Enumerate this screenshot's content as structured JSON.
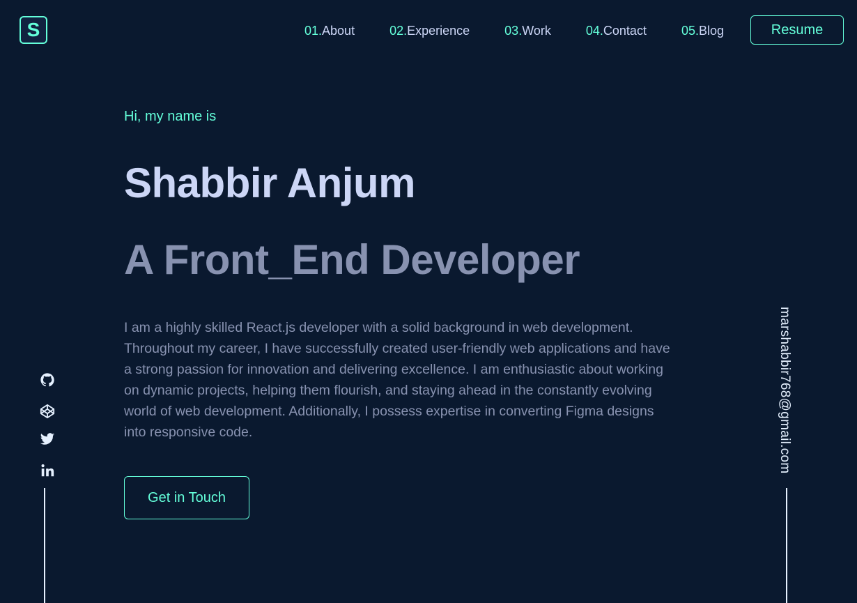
{
  "header": {
    "logo_letter": "S",
    "nav": [
      {
        "num": "01.",
        "label": "About"
      },
      {
        "num": "02.",
        "label": "Experience"
      },
      {
        "num": "03.",
        "label": "Work"
      },
      {
        "num": "04.",
        "label": "Contact"
      },
      {
        "num": "05.",
        "label": "Blog"
      }
    ],
    "resume_label": "Resume"
  },
  "hero": {
    "greeting": "Hi, my name is",
    "name": "Shabbir Anjum",
    "role": "A Front_End Developer",
    "bio": "I am a highly skilled React.js developer with a solid background in web development. Throughout my career, I have successfully created user-friendly web applications and have a strong passion for innovation and delivering excellence. I am enthusiastic about working on dynamic projects, helping them flourish, and staying ahead in the constantly evolving world of web development. Additionally, I possess expertise in converting Figma designs into responsive code.",
    "cta_label": "Get in Touch"
  },
  "social": {
    "icons": [
      "github-icon",
      "codepen-icon",
      "twitter-icon",
      "linkedin-icon"
    ]
  },
  "email": "marshabbir768@gmail.com",
  "colors": {
    "background": "#0a192f",
    "accent": "#64ffda",
    "heading": "#ccd6f6",
    "muted": "#8892b0",
    "light": "#e6f1ff"
  }
}
